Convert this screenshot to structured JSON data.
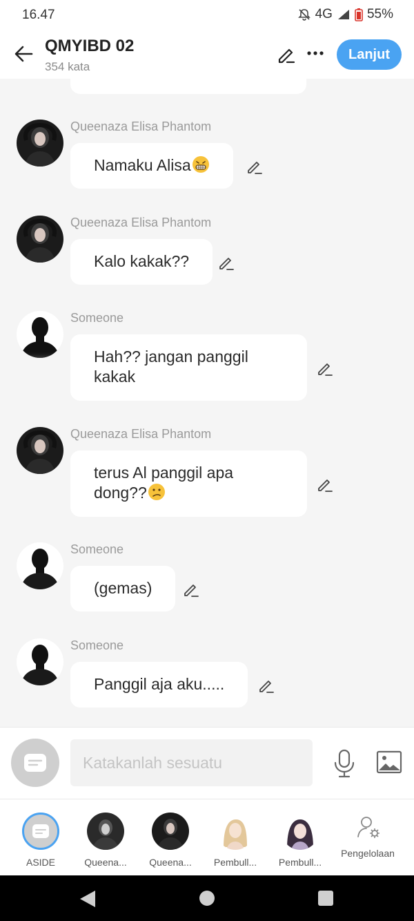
{
  "status_bar": {
    "time": "16.47",
    "network": "4G",
    "battery": "55%"
  },
  "header": {
    "title": "QMYIBD 02",
    "subtitle": "354 kata",
    "next_label": "Lanjut"
  },
  "messages": [
    {
      "sender": "Queenaza Elisa Phantom",
      "text": "Namaku Alisa",
      "emoji": "grin-emoji"
    },
    {
      "sender": "Queenaza Elisa Phantom",
      "text": "Kalo kakak??"
    },
    {
      "sender": "Someone",
      "text": "Hah?? jangan panggil kakak"
    },
    {
      "sender": "Queenaza Elisa Phantom",
      "text": "terus Al panggil apa dong??",
      "emoji": "confused-emoji"
    },
    {
      "sender": "Someone",
      "text": "(gemas)"
    },
    {
      "sender": "Someone",
      "text": "Panggil aja aku....."
    }
  ],
  "input": {
    "placeholder": "Katakanlah sesuatu"
  },
  "tabs": [
    {
      "label": "ASIDE"
    },
    {
      "label": "Queena..."
    },
    {
      "label": "Queena..."
    },
    {
      "label": "Pembull..."
    },
    {
      "label": "Pembull..."
    },
    {
      "label": "Pengelolaan"
    }
  ],
  "colors": {
    "accent": "#4aa3f2",
    "background": "#f5f5f5",
    "bubble": "#ffffff"
  }
}
